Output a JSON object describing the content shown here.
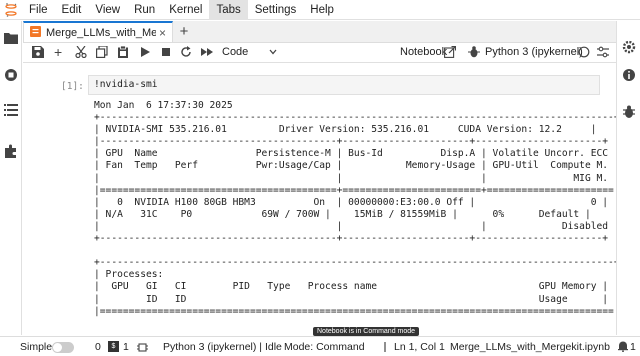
{
  "menubar": {
    "items": [
      "File",
      "Edit",
      "View",
      "Run",
      "Kernel",
      "Tabs",
      "Settings",
      "Help"
    ],
    "active": "Tabs"
  },
  "tab": {
    "label": "Merge_LLMs_with_Mergek",
    "close": "×",
    "add": "+"
  },
  "toolbar": {
    "cell_type": "Code",
    "notebook_label": "Notebook",
    "kernel_label": "Python 3 (ipykernel)"
  },
  "cell": {
    "prompt": "[1]:",
    "input": "!nvidia-smi",
    "output_lines": [
      "Mon Jan  6 17:37:30 2025",
      "+-----------------------------------------------------------------------------------------+",
      "| NVIDIA-SMI 535.216.01         Driver Version: 535.216.01     CUDA Version: 12.2     |",
      "|-----------------------------------------+----------------------+----------------------+",
      "| GPU  Name                 Persistence-M | Bus-Id          Disp.A | Volatile Uncorr. ECC |",
      "| Fan  Temp   Perf          Pwr:Usage/Cap |           Memory-Usage | GPU-Util  Compute M. |",
      "|                                         |                        |               MIG M. |",
      "|=========================================+========================+======================|",
      "|   0  NVIDIA H100 80GB HBM3          On  | 00000000:E3:00.0 Off |                    0 |",
      "| N/A   31C    P0            69W / 700W |    15MiB / 81559MiB |      0%      Default |",
      "|                                         |                        |             Disabled |",
      "+-----------------------------------------+----------------------+----------------------+",
      "",
      "+-----------------------------------------------------------------------------------------+",
      "| Processes:                                                                              |",
      "|  GPU   GI   CI        PID   Type   Process name                            GPU Memory |",
      "|        ID   ID                                                             Usage      |",
      "|=========================================================================================|"
    ]
  },
  "statusbar": {
    "mode_label": "Simple",
    "count_a": "0",
    "count_b": "1",
    "kernel_status": "Python 3 (ipykernel) | Idle",
    "mode": "Mode: Command",
    "position": "Ln 1, Col 1",
    "filename": "Merge_LLMs_with_Mergekit.ipynb",
    "notifications": "1",
    "tooltip": "Notebook is in Command mode"
  },
  "colors": {
    "accent": "#1976d2",
    "logo": "#f37726"
  }
}
